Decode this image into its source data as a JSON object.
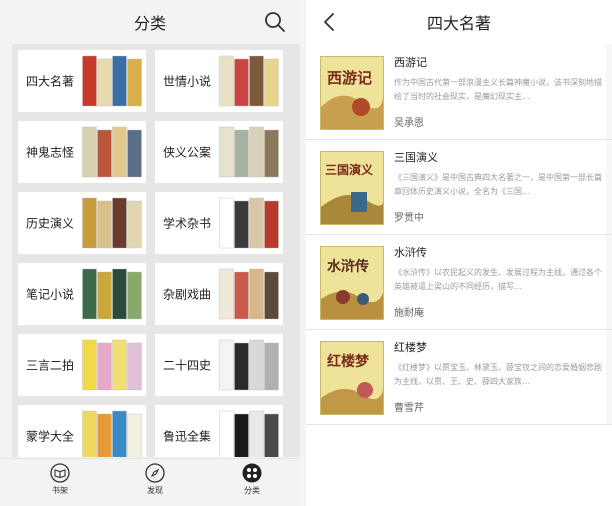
{
  "left_screen": {
    "title": "分类",
    "search_icon": "search-icon",
    "categories": [
      {
        "label": "四大名著",
        "thumb": [
          "#c8392b",
          "#e7d9b0",
          "#3a6ea5",
          "#d8b04a"
        ]
      },
      {
        "label": "世情小说",
        "thumb": [
          "#e9e1c6",
          "#c44",
          "#7a5a3a",
          "#e6d58c"
        ]
      },
      {
        "label": "神鬼志怪",
        "thumb": [
          "#d9d0b0",
          "#b8553a",
          "#e3c98a",
          "#5a6e8a"
        ]
      },
      {
        "label": "侠义公案",
        "thumb": [
          "#e8e2cc",
          "#a8b2a0",
          "#d8d0b8",
          "#8a7a5a"
        ]
      },
      {
        "label": "历史演义",
        "thumb": [
          "#c79a3a",
          "#d8c08a",
          "#6a3a2a",
          "#e2d6b0"
        ]
      },
      {
        "label": "学术杂书",
        "thumb": [
          "#ffffff",
          "#3a3a3a",
          "#d8c8a8",
          "#b83a2a"
        ]
      },
      {
        "label": "笔记小说",
        "thumb": [
          "#3a6a4a",
          "#c8a83a",
          "#2a4a3a",
          "#8aa86a"
        ]
      },
      {
        "label": "杂剧戏曲",
        "thumb": [
          "#f0e8d8",
          "#c85a4a",
          "#d8b88a",
          "#5a4a3a"
        ]
      },
      {
        "label": "三言二拍",
        "thumb": [
          "#f2d94a",
          "#e8a8c8",
          "#f0e070",
          "#e0c0d8"
        ]
      },
      {
        "label": "二十四史",
        "thumb": [
          "#f4f4f4",
          "#2a2a2a",
          "#d8d8d8",
          "#b0b0b0"
        ]
      },
      {
        "label": "蒙学大全",
        "thumb": [
          "#f0d860",
          "#e89a3a",
          "#3a8ac8",
          "#f4f0e0"
        ]
      },
      {
        "label": "鲁迅全集",
        "thumb": [
          "#ffffff",
          "#1a1a1a",
          "#e8e8e8",
          "#4a4a4a"
        ]
      }
    ],
    "tabs": [
      {
        "label": "书架",
        "icon": "bookshelf-icon"
      },
      {
        "label": "发现",
        "icon": "compass-icon"
      },
      {
        "label": "分类",
        "icon": "grid-icon"
      }
    ]
  },
  "right_screen": {
    "title": "四大名著",
    "back_icon": "back-chevron-icon",
    "books": [
      {
        "title": "西游记",
        "cover_text": "西游记",
        "desc": "作为中国古代第一部浪漫主义长篇神魔小说，该书深刻地描绘了当时的社会现实，是魔幻现实主…",
        "author": "吴承恩"
      },
      {
        "title": "三国演义",
        "cover_text": "三国演义",
        "desc": "《三国演义》是中国古典四大名著之一，是中国第一部长篇章回体历史演义小说，全名为《三国…",
        "author": "罗贯中"
      },
      {
        "title": "水浒传",
        "cover_text": "水浒传",
        "desc": "《水浒传》以农民起义的发生、发展过程为主线，通过各个英雄被逼上梁山的不同经历，描写…",
        "author": "施耐庵"
      },
      {
        "title": "红楼梦",
        "cover_text": "红楼梦",
        "desc": "《红楼梦》以贾宝玉、林黛玉、薛宝钗之间的恋爱婚姻悲剧为主线，以贾、王、史、薛四大家族…",
        "author": "曹雪芹"
      }
    ]
  }
}
